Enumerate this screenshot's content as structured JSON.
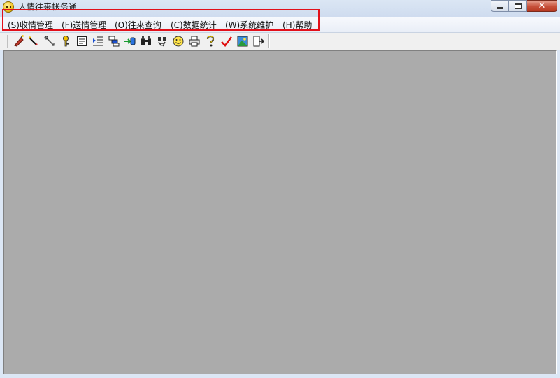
{
  "window": {
    "title": "人情往来帐务通",
    "close_glyph": "✕"
  },
  "menu": {
    "items": [
      {
        "label": "(S)收情管理"
      },
      {
        "label": "(F)送情管理"
      },
      {
        "label": "(O)往来查询"
      },
      {
        "label": "(C)数据统计"
      },
      {
        "label": "(W)系统维护"
      },
      {
        "label": "(H)帮助"
      }
    ]
  },
  "toolbar": {
    "icons": [
      "firecracker-icon",
      "wand-icon",
      "pen-icon",
      "key-icon",
      "document-icon",
      "indent-icon",
      "tree-icon",
      "import-icon",
      "binoculars-icon",
      "search-person-icon",
      "smiley-icon",
      "printer-icon",
      "help-icon",
      "check-icon",
      "image-icon",
      "exit-icon"
    ]
  },
  "colors": {
    "highlight_box": "#e2101a",
    "client_background": "#ababab"
  }
}
